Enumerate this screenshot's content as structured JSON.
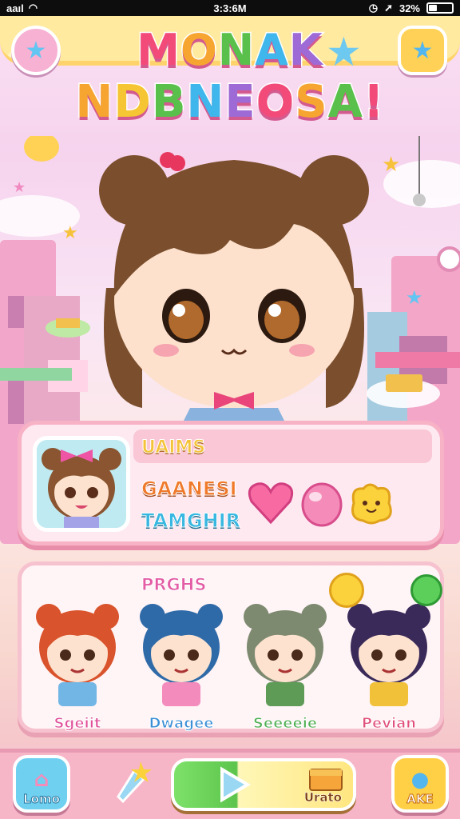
{
  "status_bar": {
    "signal": "aaıl",
    "time": "3:3:6M",
    "battery": "32%",
    "battery_level": 0.32
  },
  "header": {
    "title_line1": "MONAK",
    "title_line2": "NDBNEOSA!",
    "title_line1_colors": [
      "#f24b7a",
      "#f7a531",
      "#59c14b",
      "#3fb6ec",
      "#9e6ad6"
    ],
    "title_line2_colors": [
      "#f7a531",
      "#f6c533",
      "#59c14b",
      "#3fb6ec",
      "#9e6ad6",
      "#f24b7a",
      "#f7a531",
      "#59c14b",
      "#f24b7a"
    ],
    "left_button_icon": "star-icon",
    "right_button_icon": "star-edit-icon"
  },
  "profile_card": {
    "label_top": "UAIMS",
    "label_name": "GAANESI",
    "label_sub": "TAMGHIR",
    "items": [
      "heart-icon",
      "pink-gem-icon",
      "yellow-slime-icon"
    ]
  },
  "friends_panel": {
    "header": "PRGHS",
    "friends": [
      {
        "name": "Sgeiit",
        "hair": "#d9532c",
        "outfit": "#72b6e6",
        "name_color": "#e04f9a"
      },
      {
        "name": "Dwagee",
        "hair": "#2f6aa8",
        "outfit": "#f48bbd",
        "name_color": "#3a8fd6"
      },
      {
        "name": "Seeeeie",
        "hair": "#7d8a70",
        "outfit": "#5d9b56",
        "name_color": "#4fae52"
      },
      {
        "name": "Pevian",
        "hair": "#3a2a5a",
        "outfit": "#f2c13a",
        "name_color": "#e04f7a"
      }
    ]
  },
  "bottom_bar": {
    "home_label": "Lomo",
    "level_label": "Urato",
    "right_label": "AKE"
  }
}
